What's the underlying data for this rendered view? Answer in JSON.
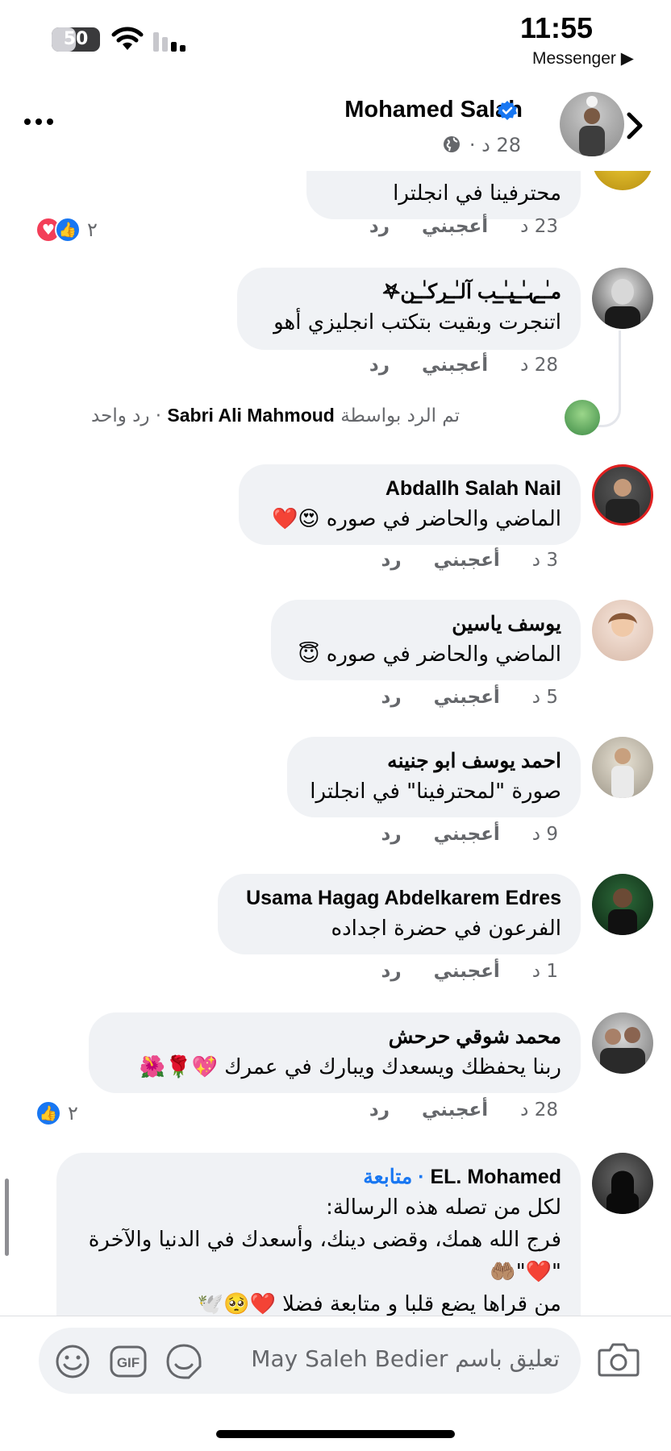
{
  "status_bar": {
    "time": "11:55",
    "battery": "50",
    "battery_level": 0.5,
    "back_app": "Messenger ▶"
  },
  "post_header": {
    "author": "Mohamed Salah",
    "meta": "28 د ·"
  },
  "comments": [
    {
      "text": "محترفينا في انجلترا",
      "time": "23 د",
      "like_label": "أعجبني",
      "reply_label": "رد",
      "reaction_count": "٢"
    },
    {
      "name": "مـٰ̲ـہـٰ̲ـيـٰ̲ـب آلـٰ̲ـرکـٰ̲ـن𖤐",
      "text": "اتنجرت وبقيت بتكتب انجليزي أهو",
      "time": "28 د",
      "like_label": "أعجبني",
      "reply_label": "رد",
      "reply_summary_prefix": "تم الرد بواسطة",
      "reply_summary_name": "Sabri Ali Mahmoud",
      "reply_summary_suffix": "· رد واحد"
    },
    {
      "name": "Abdallh Salah Nail",
      "text": "الماضي والحاضر في صوره",
      "emoji": "😍❤️",
      "time": "3 د",
      "like_label": "أعجبني",
      "reply_label": "رد"
    },
    {
      "name": "يوسف ياسين",
      "text": "الماضي والحاضر في صوره",
      "emoji": "😇",
      "time": "5 د",
      "like_label": "أعجبني",
      "reply_label": "رد"
    },
    {
      "name": "احمد يوسف ابو جنينه",
      "text": "صورة \"لمحترفينا\" في انجلترا",
      "time": "9 د",
      "like_label": "أعجبني",
      "reply_label": "رد"
    },
    {
      "name": "Usama Hagag Abdelkarem Edres",
      "text": "الفرعون في حضرة اجداده",
      "time": "1 د",
      "like_label": "أعجبني",
      "reply_label": "رد"
    },
    {
      "name": "محمد شوقي حرحش",
      "text": "ربنا يحفظك ويسعدك ويبارك في عمرك",
      "emoji": "💖🌹🌺",
      "time": "28 د",
      "like_label": "أعجبني",
      "reply_label": "رد",
      "reaction_count": "٢"
    },
    {
      "name": "EL. Mohamed",
      "follow": "· متابعة",
      "line1": "لكل من تصله هذه الرسالة:",
      "line2": "فرج الله همك، وقضى دينك، وأسعدك في الدنيا والآخرة",
      "line3": "\"❤️\"🤲🏽",
      "line4": "من قراها يضع قلبا و متابعة فضلا ❤️🥺🕊️"
    }
  ],
  "composer": {
    "placeholder": "تعليق باسم May Saleh Bedier"
  },
  "colors": {
    "accent": "#1877f2",
    "bubble": "#f0f2f5",
    "secondary_text": "#65676b",
    "heart": "#f33e58"
  }
}
